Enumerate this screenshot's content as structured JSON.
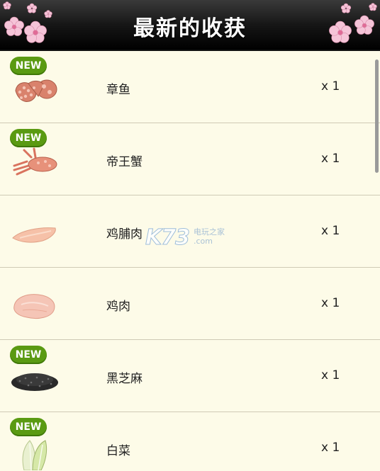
{
  "header": {
    "title": "最新的收获"
  },
  "items": [
    {
      "name": "章鱼",
      "qty": "x 1",
      "badge": "NEW",
      "icon": "octopus-icon"
    },
    {
      "name": "帝王蟹",
      "qty": "x 1",
      "badge": "NEW",
      "icon": "king-crab-icon"
    },
    {
      "name": "鸡脯肉",
      "qty": "x 1",
      "badge": "",
      "icon": "chicken-breast-icon"
    },
    {
      "name": "鸡肉",
      "qty": "x 1",
      "badge": "",
      "icon": "chicken-meat-icon"
    },
    {
      "name": "黑芝麻",
      "qty": "x 1",
      "badge": "NEW",
      "icon": "black-sesame-icon"
    },
    {
      "name": "白菜",
      "qty": "x 1",
      "badge": "NEW",
      "icon": "chinese-cabbage-icon"
    }
  ],
  "watermark": {
    "logo": "K73",
    "line1": "电玩之家",
    "line2": ".com"
  },
  "colors": {
    "header_bg": "#000000",
    "row_bg": "#fdfbe8",
    "badge_bg": "#5a9a12",
    "sakura": "#f3b8cf"
  }
}
